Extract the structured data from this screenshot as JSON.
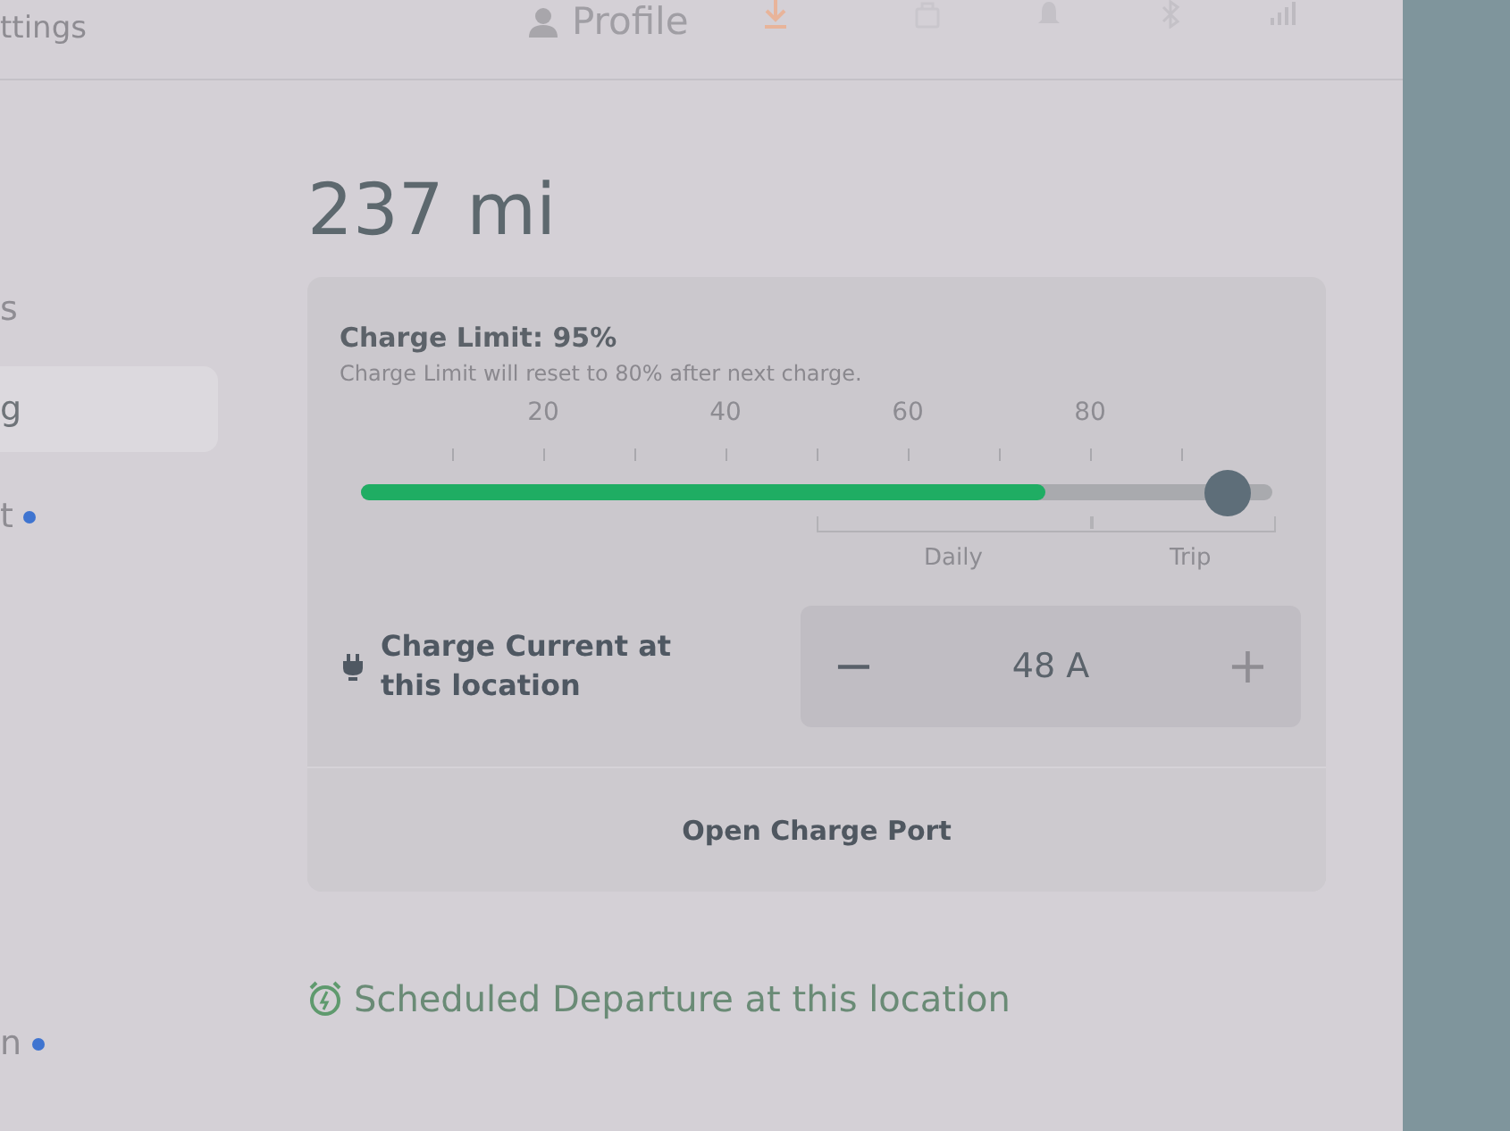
{
  "top_bar": {
    "left_label": "ttings",
    "profile_label": "Profile"
  },
  "sidebar": {
    "items": [
      {
        "label": "s",
        "selected": false,
        "dot": false
      },
      {
        "label": "g",
        "selected": true,
        "dot": false
      },
      {
        "label": "t",
        "selected": false,
        "dot": true
      },
      {
        "label": "n",
        "selected": false,
        "dot": true
      }
    ]
  },
  "range": "237 mi",
  "charge_limit": {
    "title": "Charge Limit: 95%",
    "note": "Charge Limit will reset to 80% after next charge.",
    "tick_labels": [
      "20",
      "40",
      "60",
      "80"
    ],
    "battery": {
      "level": 0.75
    },
    "slider": {
      "level": 0.95
    },
    "zones": [
      "Daily",
      "Trip"
    ]
  },
  "charge_current": {
    "label": "Charge Current at this location",
    "value": "48 A",
    "minus_symbol": "−",
    "plus_symbol": "+",
    "minus_disabled": false,
    "plus_disabled": true
  },
  "open_port_button": "Open Charge Port",
  "scheduled_departure": {
    "title": "Scheduled Departure at this location"
  }
}
